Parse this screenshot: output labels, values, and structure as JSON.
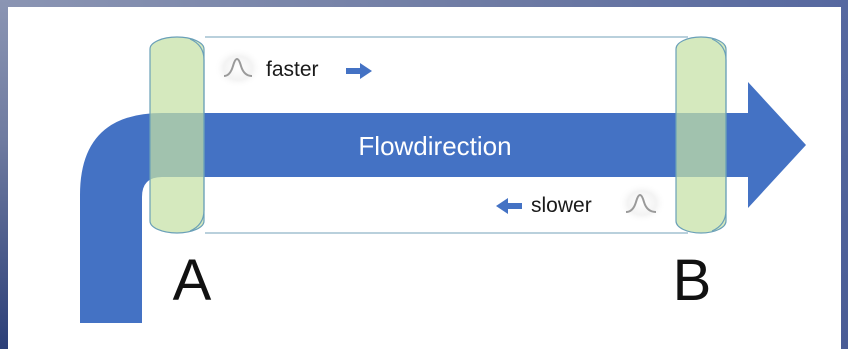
{
  "diagram": {
    "flow_label": "Flowdirection",
    "faster_label": "faster",
    "slower_label": "slower",
    "point_a_label": "A",
    "point_b_label": "B",
    "colors": {
      "arrow": "#4472c4",
      "transducer_fill": "#c5e0a5",
      "transducer_stroke": "#6aa0b8",
      "pipe_line": "#8fb4c8",
      "text_dark": "#1a1a1a",
      "text_light": "#ffffff"
    },
    "icons": [
      "wave-pulse-icon",
      "right-arrow-icon",
      "left-arrow-icon"
    ]
  }
}
